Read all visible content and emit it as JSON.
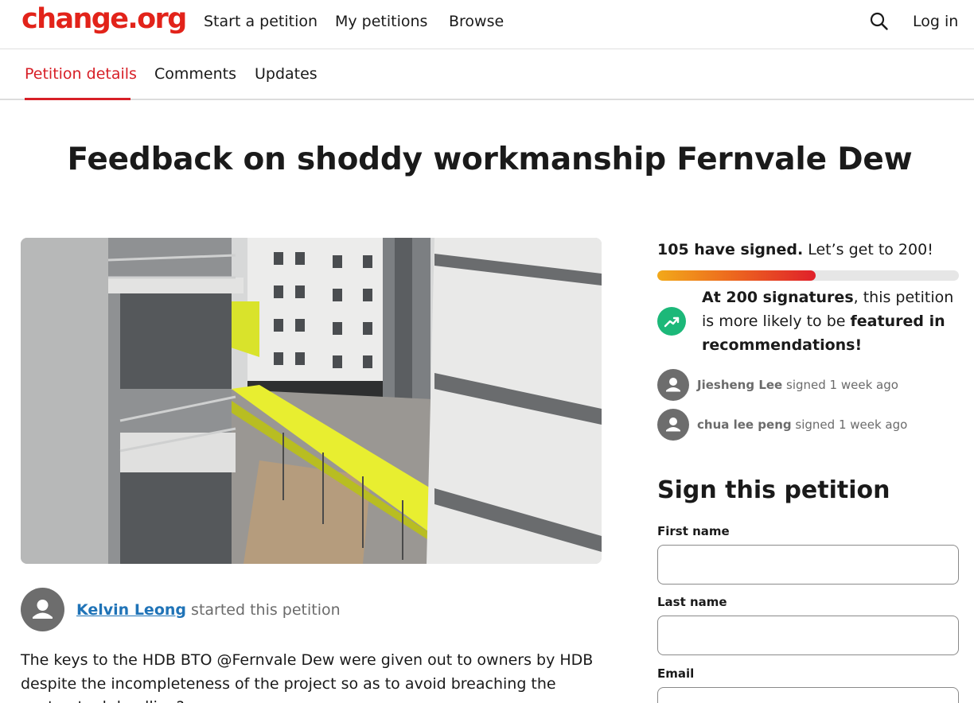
{
  "header": {
    "logo": "change.org",
    "nav": [
      "Start a petition",
      "My petitions",
      "Browse"
    ],
    "login": "Log in"
  },
  "tabs": [
    "Petition details",
    "Comments",
    "Updates"
  ],
  "petition": {
    "title": "Feedback on shoddy workmanship Fernvale Dew",
    "starter_name": "Kelvin Leong",
    "starter_suffix": " started this petition",
    "description": "The keys to the HDB BTO @Fernvale Dew were given out to owners by HDB despite the incompleteness of the project so as to avoid breaching the contractual deadline?..."
  },
  "signatures": {
    "count_text": "105 have signed.",
    "goal_text": " Let’s get to 200!",
    "count": 105,
    "goal": 200,
    "milestone_bold": "At 200 signatures",
    "milestone_mid": ", this petition is more likely to be ",
    "milestone_bold2": "featured in recommendations!",
    "recent": [
      {
        "name": "Jiesheng Lee",
        "action": " signed 1 week ago"
      },
      {
        "name": "chua lee peng",
        "action": " signed 1 week ago"
      }
    ]
  },
  "sign_form": {
    "heading": "Sign this petition",
    "first_name_label": "First name",
    "last_name_label": "Last name",
    "email_label": "Email"
  },
  "colors": {
    "brand": "#e2231a",
    "link": "#1f73b7",
    "success": "#1cb879"
  }
}
